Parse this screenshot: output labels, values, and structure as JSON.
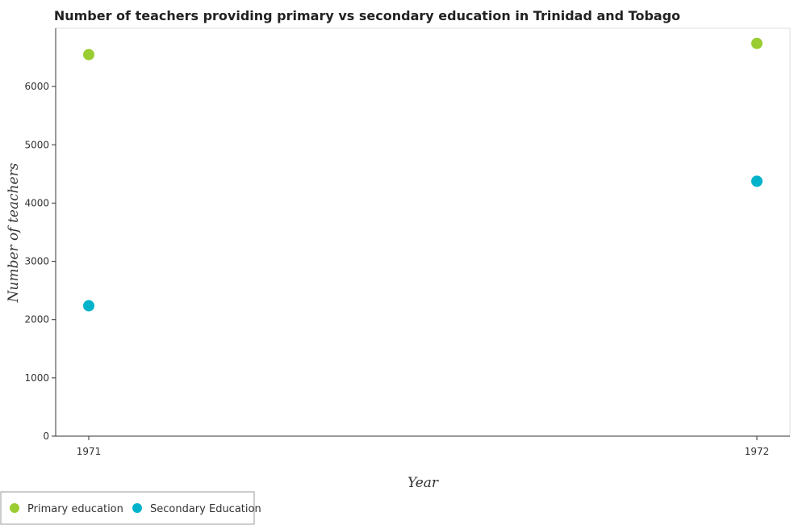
{
  "chart_data": {
    "type": "scatter",
    "title": "Number of teachers providing primary vs secondary education in Trinidad and Tobago",
    "xlabel": "Year",
    "ylabel": "Number of teachers",
    "categories": [
      "1971",
      "1972"
    ],
    "ylim": [
      0,
      7000
    ],
    "yticks": [
      0,
      1000,
      2000,
      3000,
      4000,
      5000,
      6000
    ],
    "grid": false,
    "legend_position": "bottom-left",
    "series": [
      {
        "name": "Primary education",
        "color": "#9acd32",
        "values": [
          6548,
          6740
        ]
      },
      {
        "name": "Secondary Education",
        "color": "#00b2ca",
        "values": [
          2238,
          4375
        ]
      }
    ]
  }
}
